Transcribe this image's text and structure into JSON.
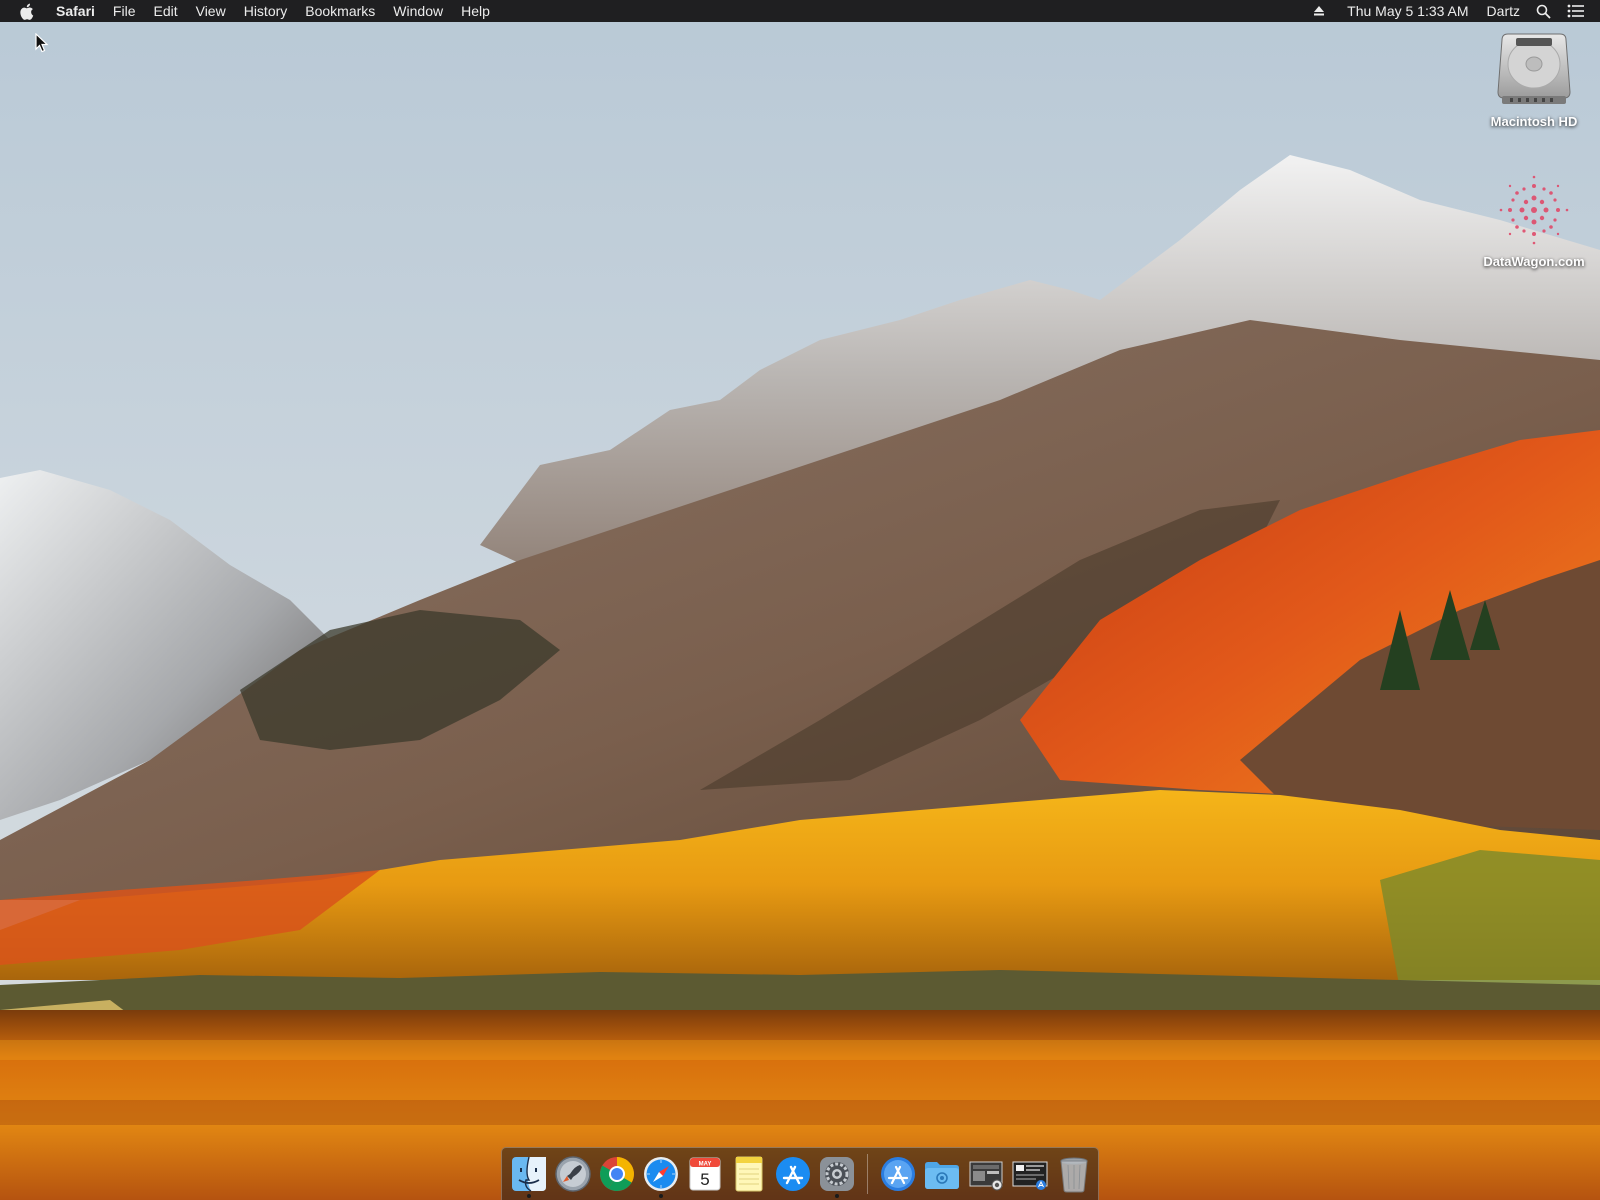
{
  "menubar": {
    "app_name": "Safari",
    "menus": [
      "File",
      "Edit",
      "View",
      "History",
      "Bookmarks",
      "Window",
      "Help"
    ],
    "clock": "Thu May 5  1:33 AM",
    "user": "Dartz",
    "icons": [
      "apple-logo-icon",
      "eject-icon",
      "spotlight-search-icon",
      "notification-center-icon"
    ]
  },
  "desktop": {
    "icons": [
      {
        "label": "Macintosh HD",
        "icon": "hard-drive-icon"
      },
      {
        "label": "DataWagon.com",
        "icon": "datawagon-logo-icon"
      }
    ]
  },
  "dock": {
    "apps": [
      {
        "icon": "finder-icon",
        "running": true
      },
      {
        "icon": "launchpad-icon",
        "running": false
      },
      {
        "icon": "chrome-icon",
        "running": false
      },
      {
        "icon": "safari-icon",
        "running": true
      },
      {
        "icon": "calendar-icon",
        "running": false,
        "month": "MAY",
        "day": "5"
      },
      {
        "icon": "notes-icon",
        "running": false
      },
      {
        "icon": "app-store-icon",
        "running": false
      },
      {
        "icon": "system-preferences-icon",
        "running": true
      }
    ],
    "others": [
      {
        "icon": "applications-folder-icon"
      },
      {
        "icon": "downloads-folder-icon"
      },
      {
        "icon": "screenshot-stack-icon"
      },
      {
        "icon": "document-stack-icon"
      },
      {
        "icon": "trash-icon"
      }
    ]
  }
}
